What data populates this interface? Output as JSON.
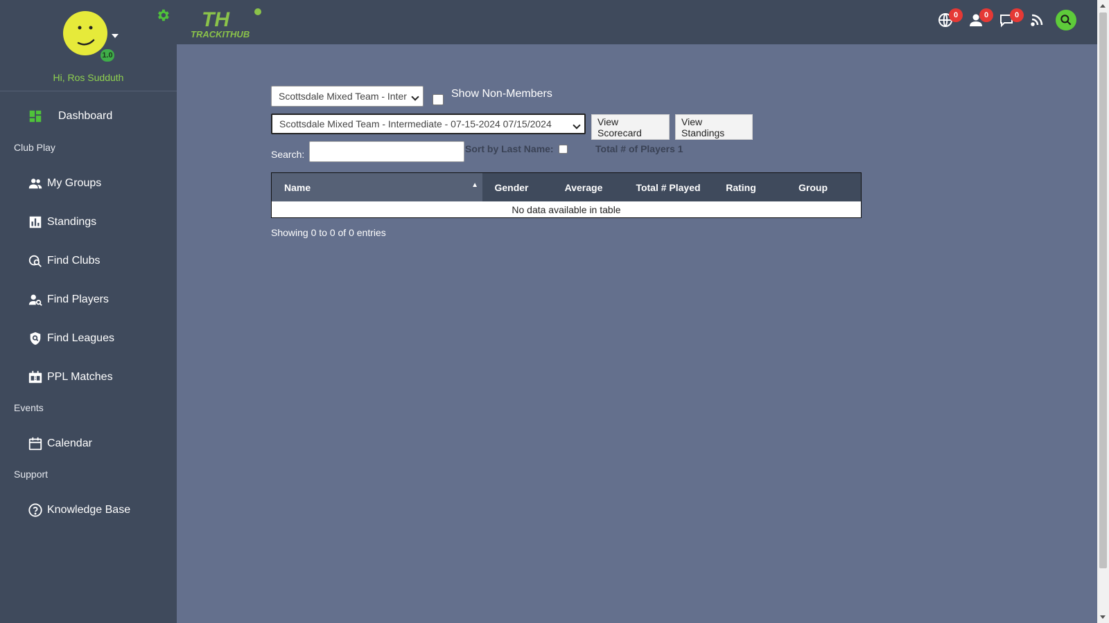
{
  "user": {
    "greeting": "Hi, Ros Sudduth",
    "level": "1.0"
  },
  "brand": {
    "name": "TRACKITHUB",
    "monogram": "TH",
    "accent": "#5ecb3a"
  },
  "nav": {
    "dashboard": "Dashboard",
    "sections": {
      "club_play": "Club Play",
      "events": "Events",
      "support": "Support"
    },
    "items": {
      "my_groups": "My Groups",
      "standings": "Standings",
      "find_clubs": "Find Clubs",
      "find_players": "Find Players",
      "find_leagues": "Find Leagues",
      "ppl_matches": "PPL Matches",
      "calendar": "Calendar",
      "knowledge_base": "Knowledge Base"
    }
  },
  "header": {
    "badges": {
      "globe": "0",
      "user": "0",
      "chat": "0"
    }
  },
  "filters": {
    "group_select": "Scottsdale Mixed Team - Inter",
    "show_non_members": "Show Non-Members",
    "event_select": "Scottsdale Mixed Team - Intermediate - 07-15-2024 07/15/2024",
    "view_scorecard": "View Scorecard",
    "view_standings": "View Standings",
    "search_label": "Search:",
    "search_value": "",
    "sort_by_last_name": "Sort by Last Name:",
    "total_players": "Total # of Players 1"
  },
  "table": {
    "columns": [
      "Name",
      "Gender",
      "Average",
      "Total # Played",
      "Rating",
      "Group"
    ],
    "empty": "No data available in table",
    "info": "Showing 0 to 0 of 0 entries"
  }
}
